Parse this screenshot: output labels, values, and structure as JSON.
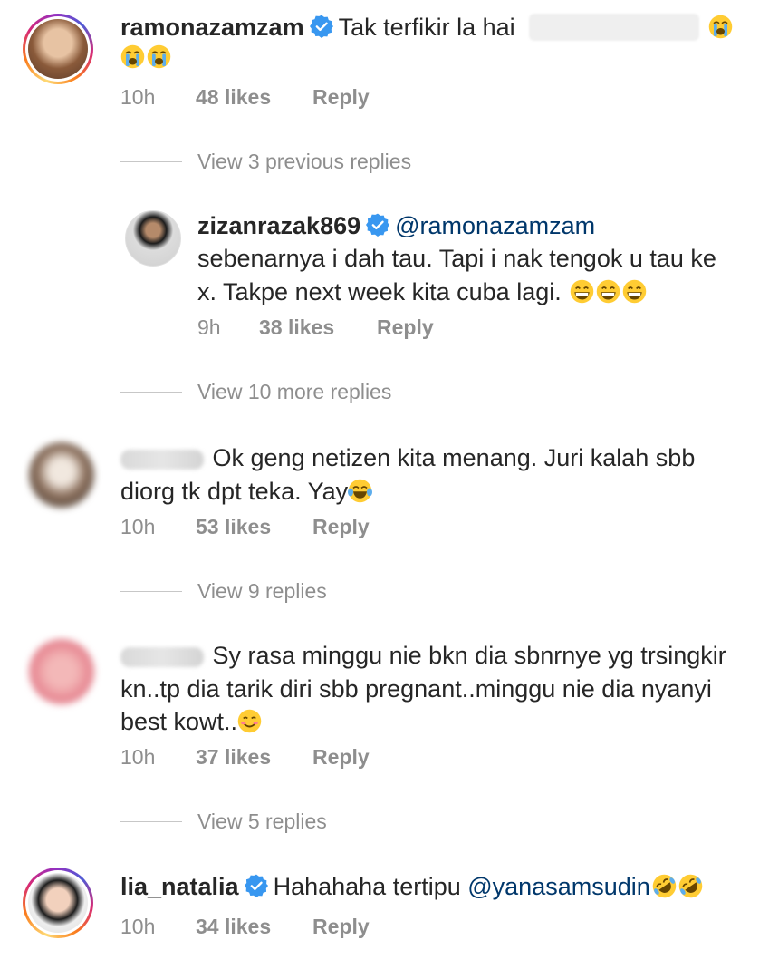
{
  "comments": [
    {
      "username": "ramonazamzam",
      "verified": true,
      "text": "Tak terfikir la hai",
      "emoji_after": [
        "loudly-crying-face",
        "loudly-crying-face",
        "loudly-crying-face"
      ],
      "time": "10h",
      "likes": "48 likes",
      "reply": "Reply",
      "view_replies": "View 3 previous replies"
    },
    {
      "username": "zizanrazak869",
      "verified": true,
      "mention": "@ramonazamzam",
      "text_line1": "sebenarnya i dah tau. Tapi i nak tengok u tau ke",
      "text_line2": "x. Takpe next week kita cuba lagi.",
      "emoji_after": [
        "grinning-face",
        "grinning-face",
        "grinning-face"
      ],
      "time": "9h",
      "likes": "38 likes",
      "reply": "Reply",
      "view_replies": "View 10 more replies"
    },
    {
      "username_hidden": true,
      "text_line1": "Ok geng netizen kita menang. Juri kalah sbb",
      "text_line2": "diorg tk dpt teka. Yay",
      "emoji_after": [
        "tears-of-joy-face"
      ],
      "time": "10h",
      "likes": "53 likes",
      "reply": "Reply",
      "view_replies": "View 9 replies"
    },
    {
      "username_hidden": true,
      "text_line1": "Sy rasa minggu nie bkn dia sbnrnye yg trsingkir",
      "text_line2": "kn..tp dia tarik diri sbb pregnant..minggu nie dia nyanyi",
      "text_line3": "best kowt..",
      "emoji_after": [
        "smiling-face"
      ],
      "time": "10h",
      "likes": "37 likes",
      "reply": "Reply",
      "view_replies": "View 5 replies"
    },
    {
      "username": "lia_natalia",
      "verified": true,
      "text": "Hahahaha tertipu",
      "mention": "@yanasamsudin",
      "emoji_after": [
        "rolling-on-floor-laughing",
        "rolling-on-floor-laughing"
      ],
      "time": "10h",
      "likes": "34 likes",
      "reply": "Reply"
    }
  ],
  "colors": {
    "text": "#262626",
    "meta": "#8e8e8e",
    "verified_blue": "#3897f0",
    "mention": "#00376b",
    "divider": "#c7c7c7"
  }
}
